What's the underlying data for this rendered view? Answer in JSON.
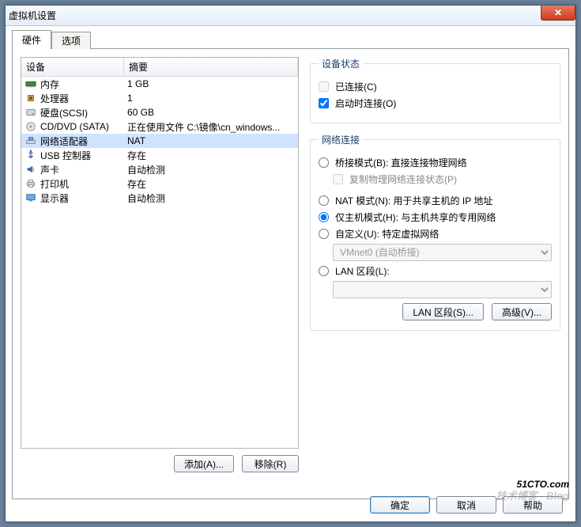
{
  "title": "虚拟机设置",
  "tabs": {
    "hardware": "硬件",
    "options": "选项"
  },
  "columns": {
    "device": "设备",
    "summary": "摘要"
  },
  "devices": [
    {
      "icon": "memory",
      "name": "内存",
      "summary": "1 GB"
    },
    {
      "icon": "cpu",
      "name": "处理器",
      "summary": "1"
    },
    {
      "icon": "disk",
      "name": "硬盘(SCSI)",
      "summary": "60 GB"
    },
    {
      "icon": "cd",
      "name": "CD/DVD (SATA)",
      "summary": "正在使用文件 C:\\镜像\\cn_windows..."
    },
    {
      "icon": "net",
      "name": "网络适配器",
      "summary": "NAT",
      "selected": true
    },
    {
      "icon": "usb",
      "name": "USB 控制器",
      "summary": "存在"
    },
    {
      "icon": "sound",
      "name": "声卡",
      "summary": "自动检测"
    },
    {
      "icon": "printer",
      "name": "打印机",
      "summary": "存在"
    },
    {
      "icon": "display",
      "name": "显示器",
      "summary": "自动检测"
    }
  ],
  "left_buttons": {
    "add": "添加(A)...",
    "remove": "移除(R)"
  },
  "status": {
    "legend": "设备状态",
    "connected": {
      "label": "已连接(C)",
      "checked": false,
      "disabled": true
    },
    "connect_at_power": {
      "label": "启动时连接(O)",
      "checked": true
    }
  },
  "network": {
    "legend": "网络连接",
    "bridged": {
      "label": "桥接模式(B): 直接连接物理网络"
    },
    "replicate": {
      "label": "复制物理网络连接状态(P)",
      "disabled": true
    },
    "nat": {
      "label": "NAT 模式(N): 用于共享主机的 IP 地址"
    },
    "hostonly": {
      "label": "仅主机模式(H): 与主机共享的专用网络",
      "checked": true
    },
    "custom": {
      "label": "自定义(U): 特定虚拟网络"
    },
    "vmnet": {
      "value": "VMnet0 (自动桥接)",
      "disabled": true
    },
    "lanseg": {
      "label": "LAN 区段(L):"
    },
    "lanseg_select": {
      "value": "",
      "disabled": true
    },
    "buttons": {
      "lanseg": "LAN 区段(S)...",
      "advanced": "高级(V)..."
    }
  },
  "footer": {
    "ok": "确定",
    "cancel": "取消",
    "help": "帮助"
  },
  "watermark": {
    "main": "51CTO.com",
    "sub": "技术博客 - Blog"
  }
}
